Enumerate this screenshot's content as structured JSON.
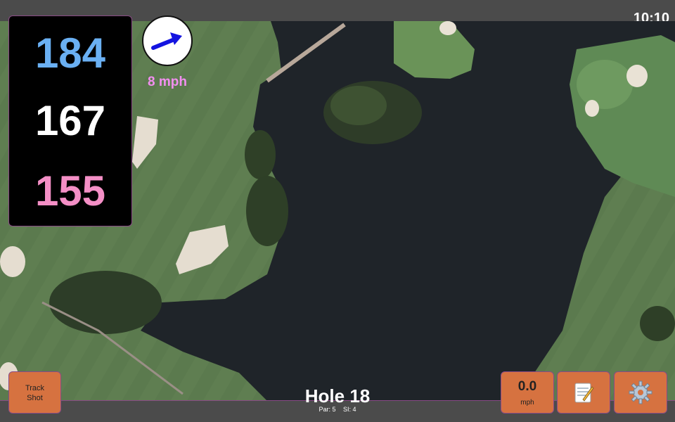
{
  "status_bar": {
    "time": "10:10"
  },
  "distances": {
    "back": "184",
    "middle": "167",
    "front": "155"
  },
  "wind": {
    "speed": "8 mph",
    "arrow_icon": "wind-arrow-icon"
  },
  "hole": {
    "title": "Hole 18",
    "par": "Par: 5",
    "stroke_index": "SI: 4"
  },
  "buttons": {
    "track_shot_line1": "Track",
    "track_shot_line2": "Shot",
    "speed_value": "0.0",
    "speed_unit": "mph",
    "notes_icon": "notepad-icon",
    "settings_icon": "gear-icon"
  },
  "colors": {
    "back": "#6ab0f3",
    "middle": "#ffffff",
    "front": "#f48fc6",
    "wind_text": "#f28ff0",
    "button": "#d67240",
    "water": "#1f2429"
  }
}
